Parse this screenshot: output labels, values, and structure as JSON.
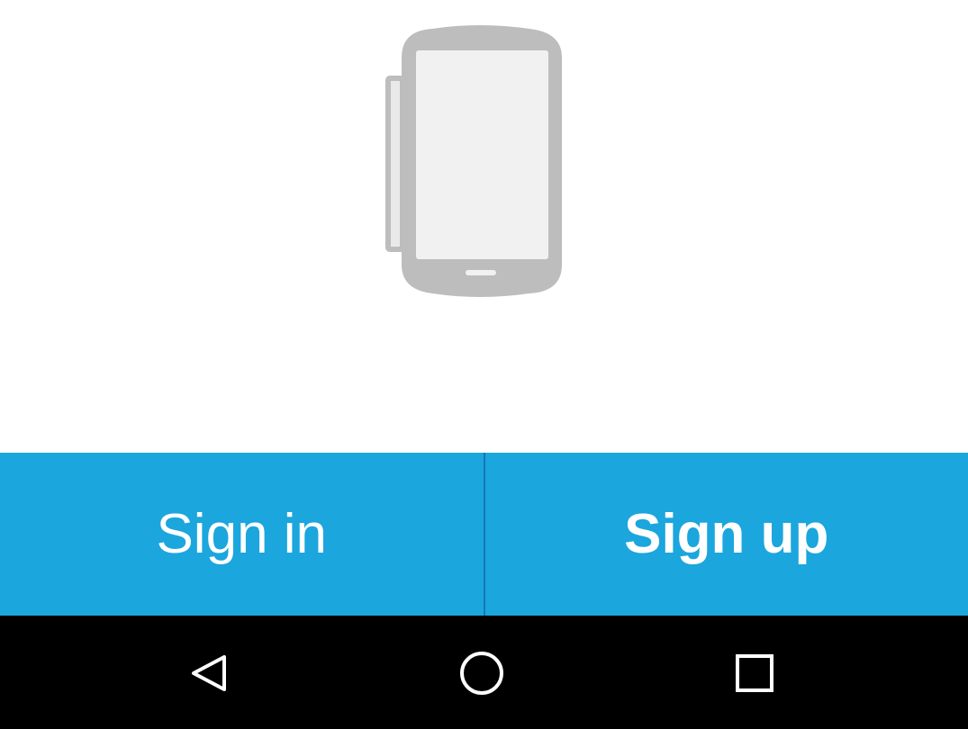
{
  "illustration": {
    "icon": "phone-device-icon",
    "body_color": "#bdbdbd",
    "screen_color": "#f1f1f1"
  },
  "actions": {
    "sign_in_label": "Sign in",
    "sign_up_label": "Sign up",
    "bar_color": "#1ba6dd",
    "divider_color": "#1576b8",
    "text_color": "#ffffff"
  },
  "navigation": {
    "background": "#000000",
    "buttons": [
      {
        "icon": "back-triangle-icon"
      },
      {
        "icon": "home-circle-icon"
      },
      {
        "icon": "recents-square-icon"
      }
    ]
  }
}
